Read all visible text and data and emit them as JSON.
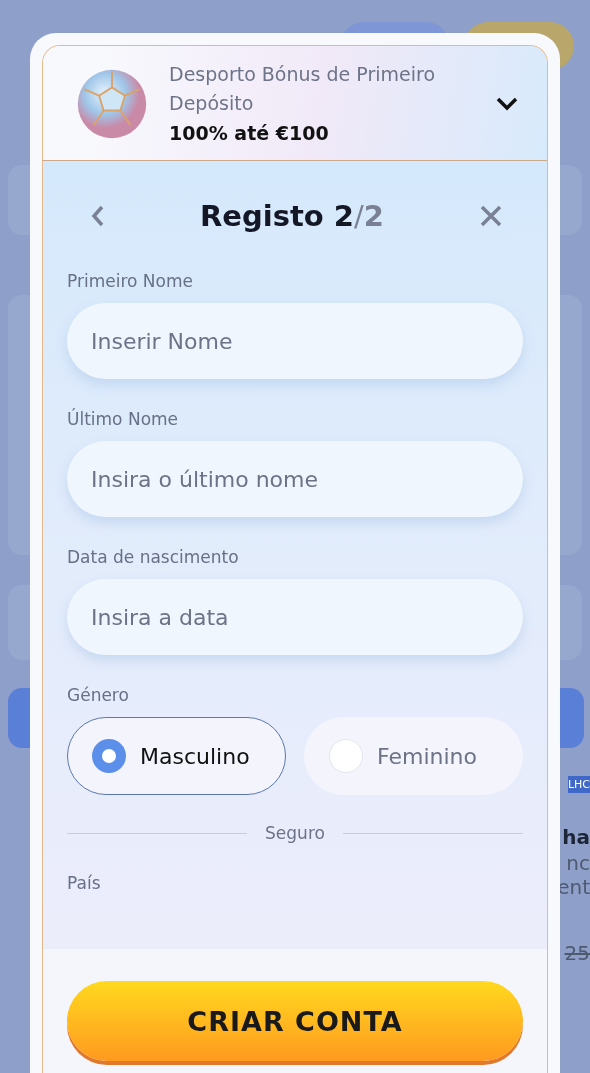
{
  "background_fragments": [
    {
      "text": "LHC",
      "kind": "tag"
    },
    {
      "text": "ha",
      "kind": "bold"
    },
    {
      "text": "nc",
      "kind": "plain"
    },
    {
      "text": "ent",
      "kind": "plain"
    },
    {
      "text": "25",
      "kind": "struck"
    }
  ],
  "promo": {
    "title": "Desporto Bónus de Primeiro Depósito",
    "offer": "100% até €100",
    "expanded": false
  },
  "header": {
    "title": "Registo",
    "step": "2",
    "separator": "/",
    "total": "2"
  },
  "fields": [
    {
      "label": "Primeiro Nome",
      "placeholder": "Inserir Nome"
    },
    {
      "label": "Último Nome",
      "placeholder": "Insira o último nome"
    },
    {
      "label": "Data de nascimento",
      "placeholder": "Insira a data"
    }
  ],
  "gender": {
    "label": "Género",
    "options": [
      {
        "label": "Masculino",
        "selected": true
      },
      {
        "label": "Feminino",
        "selected": false
      }
    ]
  },
  "divider_label": "Seguro",
  "country": {
    "label": "País"
  },
  "submit": {
    "label": "CRIAR CONTA"
  }
}
